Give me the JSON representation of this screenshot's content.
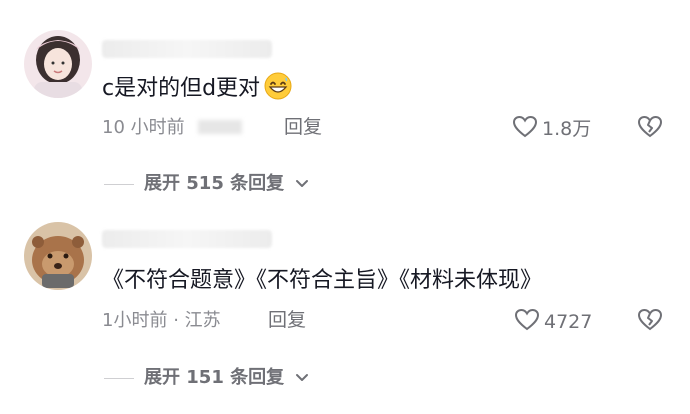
{
  "comments": [
    {
      "text": "c是对的但d更对",
      "emoji": "grinning-sweat-emoji",
      "time": "10 小时前",
      "location": "",
      "reply_label": "回复",
      "likes": "1.8万",
      "expand_label": "展开 515 条回复"
    },
    {
      "text": "《不符合题意》《不符合主旨》《材料未体现》",
      "emoji": "",
      "time": "1小时前",
      "location": "· 江苏",
      "reply_label": "回复",
      "likes": "4727",
      "expand_label": "展开 151 条回复"
    }
  ],
  "colors": {
    "text": "#161823",
    "secondary": "#8a8b91",
    "action": "#6f7076"
  },
  "icons": [
    "heart-outline-icon",
    "broken-heart-icon",
    "chevron-down-icon"
  ]
}
